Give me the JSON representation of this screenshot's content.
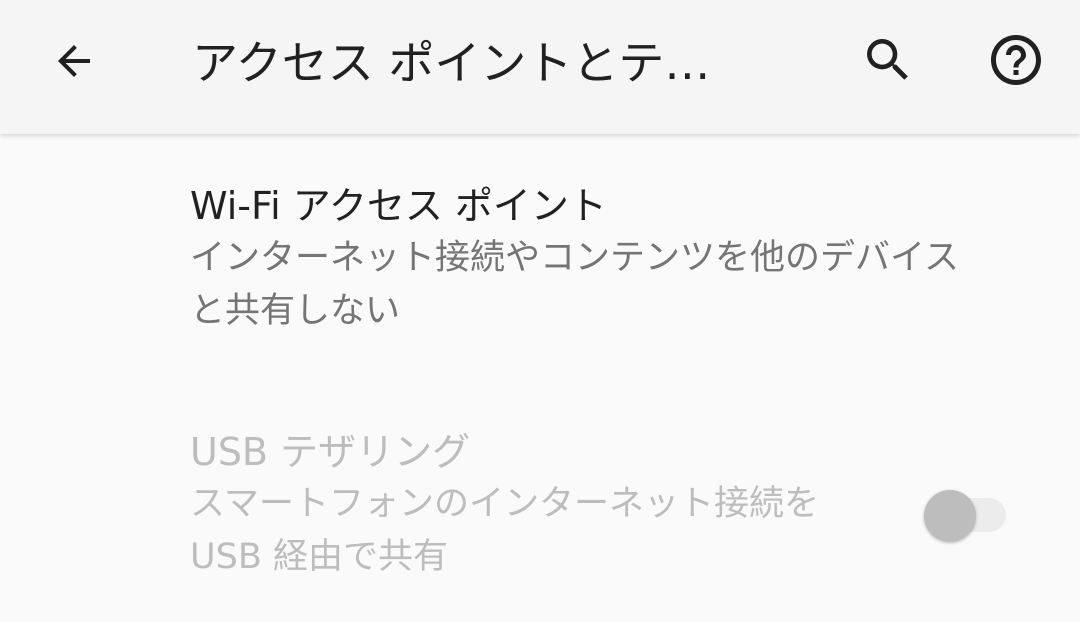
{
  "app_bar": {
    "title": "アクセス ポイントとテ…",
    "back_icon": "arrow-back-icon",
    "search_icon": "search-icon",
    "help_icon": "help-circle-icon"
  },
  "preferences": [
    {
      "title": "Wi-Fi アクセス ポイント",
      "summary": "インターネット接続やコンテンツを他のデバイス\nと共有しない",
      "enabled": true
    },
    {
      "title": "USB テザリング",
      "summary": "スマートフォンのインターネット接続を\nUSB 経由で共有",
      "enabled": false,
      "switch_on": false
    }
  ],
  "colors": {
    "app_bar_bg": "#f5f5f5",
    "page_bg": "#fafafa",
    "primary_text": "#212121",
    "secondary_text": "#757575",
    "disabled_text": "#bdbdbd"
  }
}
